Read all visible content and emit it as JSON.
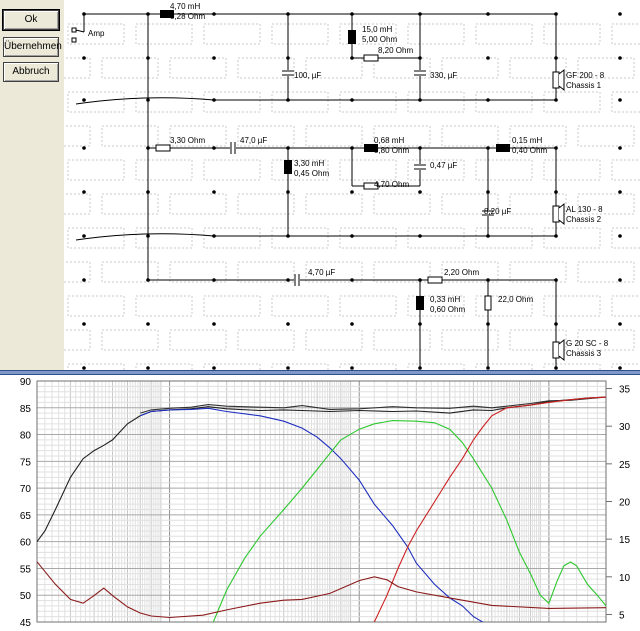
{
  "buttons": {
    "ok": "Ok",
    "apply": "Übernehmen",
    "cancel": "Abbruch"
  },
  "schematic": {
    "amp_label": "Amp",
    "components": [
      {
        "id": "l1",
        "lines": [
          "4,70 mH",
          "0,28 Ohm"
        ]
      },
      {
        "id": "l2",
        "lines": [
          "15,0 mH",
          "5,00 Ohm"
        ]
      },
      {
        "id": "r1",
        "lines": [
          "8,20 Ohm"
        ]
      },
      {
        "id": "c1",
        "lines": [
          "100, µF"
        ]
      },
      {
        "id": "c2",
        "lines": [
          "330, µF"
        ]
      },
      {
        "id": "spk1",
        "lines": [
          "GF 200 - 8",
          "Chassis 1"
        ]
      },
      {
        "id": "r2",
        "lines": [
          "3,30 Ohm"
        ]
      },
      {
        "id": "c3",
        "lines": [
          "47,0 µF"
        ]
      },
      {
        "id": "l3",
        "lines": [
          "3,30 mH",
          "0,45 Ohm"
        ]
      },
      {
        "id": "l4",
        "lines": [
          "0,68 mH",
          "0,80 Ohm"
        ]
      },
      {
        "id": "c4",
        "lines": [
          "0,47 µF"
        ]
      },
      {
        "id": "r3",
        "lines": [
          "4,70 Ohm"
        ]
      },
      {
        "id": "l5",
        "lines": [
          "0,15 mH",
          "0,40 Ohm"
        ]
      },
      {
        "id": "c5",
        "lines": [
          "8,20 µF"
        ]
      },
      {
        "id": "spk2",
        "lines": [
          "AL 130 - 8",
          "Chassis 2"
        ]
      },
      {
        "id": "c6",
        "lines": [
          "4,70 µF"
        ]
      },
      {
        "id": "r4",
        "lines": [
          "2,20 Ohm"
        ]
      },
      {
        "id": "l6",
        "lines": [
          "0,33 mH",
          "0,60 Ohm"
        ]
      },
      {
        "id": "r5",
        "lines": [
          "22,0 Ohm"
        ]
      },
      {
        "id": "spk3",
        "lines": [
          "G 20 SC - 8",
          "Chassis 3"
        ]
      }
    ]
  },
  "chart_data": {
    "type": "line",
    "x_scale": "log",
    "xlim": [
      20,
      20000
    ],
    "ylim_left": [
      45,
      90
    ],
    "ylim_right": [
      4,
      36
    ],
    "yticks_left": [
      "90",
      "85",
      "80",
      "75",
      "70",
      "65",
      "60",
      "55",
      "50",
      "45"
    ],
    "yticks_right": [
      "35",
      "30",
      "25",
      "20",
      "15",
      "10",
      "5"
    ],
    "grid": true,
    "colors": {
      "total": "#202020",
      "woofer": "#1f2fbf",
      "mid": "#2cc82c",
      "tweeter": "#cc2020",
      "impedance": "#8b1a1a",
      "upper": "#303030"
    },
    "series": [
      {
        "id": "total",
        "color": "#202020",
        "axis": "left",
        "points": [
          [
            20,
            60
          ],
          [
            22,
            62
          ],
          [
            25,
            66
          ],
          [
            30,
            72
          ],
          [
            35,
            75.5
          ],
          [
            40,
            77
          ],
          [
            45,
            78
          ],
          [
            50,
            79
          ],
          [
            60,
            82
          ],
          [
            70,
            83.5
          ],
          [
            80,
            84.3
          ],
          [
            100,
            84.6
          ],
          [
            130,
            84.8
          ],
          [
            160,
            85.2
          ],
          [
            200,
            84.8
          ],
          [
            300,
            84.5
          ],
          [
            400,
            84.6
          ],
          [
            500,
            84.5
          ],
          [
            700,
            84.3
          ],
          [
            1000,
            84.5
          ],
          [
            1500,
            84.3
          ],
          [
            2000,
            84.4
          ],
          [
            3000,
            84
          ],
          [
            4000,
            84.6
          ],
          [
            5000,
            84.5
          ],
          [
            6000,
            85
          ],
          [
            8000,
            85.5
          ],
          [
            10000,
            86.2
          ],
          [
            13000,
            86.5
          ],
          [
            16000,
            86.8
          ],
          [
            20000,
            87
          ]
        ]
      },
      {
        "id": "upper",
        "color": "#303030",
        "axis": "left",
        "points": [
          [
            70,
            84
          ],
          [
            80,
            84.6
          ],
          [
            100,
            84.9
          ],
          [
            130,
            85.1
          ],
          [
            160,
            85.6
          ],
          [
            200,
            85.3
          ],
          [
            300,
            85.1
          ],
          [
            400,
            85
          ],
          [
            500,
            85.4
          ],
          [
            700,
            84.7
          ],
          [
            1000,
            84.8
          ],
          [
            1500,
            85.2
          ],
          [
            2000,
            85
          ],
          [
            3000,
            84.9
          ],
          [
            4000,
            85.3
          ],
          [
            5000,
            85
          ],
          [
            6000,
            85.3
          ],
          [
            8000,
            85.8
          ],
          [
            10000,
            86.3
          ],
          [
            13000,
            86.4
          ],
          [
            16000,
            86.7
          ],
          [
            20000,
            87
          ]
        ]
      },
      {
        "id": "woofer",
        "color": "#1f2fbf",
        "axis": "left",
        "points": [
          [
            70,
            83.5
          ],
          [
            80,
            84.3
          ],
          [
            100,
            84.6
          ],
          [
            130,
            84.7
          ],
          [
            160,
            84.9
          ],
          [
            200,
            84.3
          ],
          [
            300,
            83.5
          ],
          [
            400,
            82.5
          ],
          [
            500,
            81.2
          ],
          [
            600,
            79.5
          ],
          [
            700,
            77.5
          ],
          [
            800,
            75.5
          ],
          [
            1000,
            71.5
          ],
          [
            1200,
            67
          ],
          [
            1500,
            63
          ],
          [
            1800,
            59
          ],
          [
            2000,
            56
          ],
          [
            2500,
            52
          ],
          [
            3000,
            49.5
          ],
          [
            3500,
            48
          ],
          [
            4000,
            46
          ],
          [
            5000,
            44
          ]
        ]
      },
      {
        "id": "mid",
        "color": "#2cc82c",
        "axis": "left",
        "points": [
          [
            170,
            45
          ],
          [
            200,
            51
          ],
          [
            250,
            57
          ],
          [
            300,
            61
          ],
          [
            400,
            66
          ],
          [
            500,
            70
          ],
          [
            600,
            73.5
          ],
          [
            700,
            76.5
          ],
          [
            800,
            79
          ],
          [
            1000,
            81
          ],
          [
            1200,
            82
          ],
          [
            1500,
            82.6
          ],
          [
            2000,
            82.5
          ],
          [
            2500,
            82.2
          ],
          [
            3000,
            81
          ],
          [
            3500,
            78.5
          ],
          [
            4000,
            75.5
          ],
          [
            5000,
            70
          ],
          [
            6000,
            64
          ],
          [
            7000,
            58
          ],
          [
            8000,
            54
          ],
          [
            9000,
            50
          ],
          [
            10000,
            48.5
          ],
          [
            11000,
            52.5
          ],
          [
            12000,
            55.5
          ],
          [
            13000,
            56.2
          ],
          [
            14000,
            55.5
          ],
          [
            16000,
            52
          ],
          [
            18000,
            50
          ],
          [
            20000,
            48
          ]
        ]
      },
      {
        "id": "tweeter",
        "color": "#cc2020",
        "axis": "left",
        "points": [
          [
            1200,
            45
          ],
          [
            1400,
            50
          ],
          [
            1600,
            55
          ],
          [
            1800,
            59
          ],
          [
            2000,
            62
          ],
          [
            2500,
            67.5
          ],
          [
            3000,
            72
          ],
          [
            3500,
            75.5
          ],
          [
            4000,
            79
          ],
          [
            4500,
            81.5
          ],
          [
            5000,
            83.5
          ],
          [
            6000,
            85
          ],
          [
            8000,
            85.5
          ],
          [
            10000,
            86
          ],
          [
            13000,
            86.5
          ],
          [
            16000,
            86.8
          ],
          [
            20000,
            87
          ]
        ]
      },
      {
        "id": "impedance",
        "color": "#8b1a1a",
        "axis": "right",
        "points": [
          [
            20,
            12
          ],
          [
            25,
            9
          ],
          [
            30,
            7
          ],
          [
            35,
            6.5
          ],
          [
            40,
            7.5
          ],
          [
            45,
            8.5
          ],
          [
            50,
            7.5
          ],
          [
            60,
            6
          ],
          [
            70,
            5.2
          ],
          [
            80,
            4.8
          ],
          [
            100,
            4.6
          ],
          [
            150,
            4.9
          ],
          [
            200,
            5.6
          ],
          [
            300,
            6.5
          ],
          [
            400,
            6.9
          ],
          [
            500,
            7
          ],
          [
            700,
            7.8
          ],
          [
            1000,
            9.5
          ],
          [
            1200,
            10
          ],
          [
            1400,
            9.6
          ],
          [
            1600,
            8.7
          ],
          [
            2000,
            8
          ],
          [
            3000,
            7.2
          ],
          [
            5000,
            6.2
          ],
          [
            10000,
            5.8
          ],
          [
            20000,
            5.9
          ]
        ]
      }
    ]
  }
}
